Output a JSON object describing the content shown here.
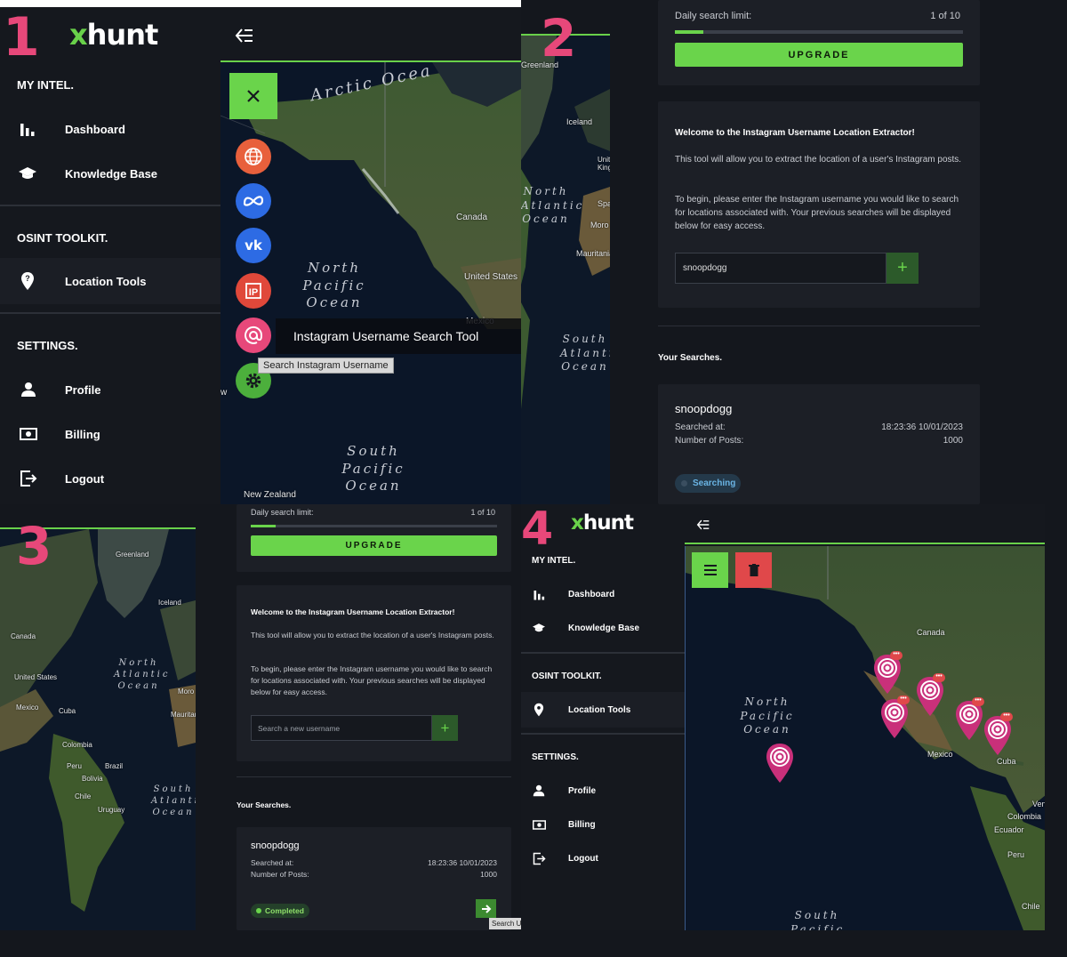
{
  "panel_numbers": [
    "1",
    "2",
    "3",
    "4"
  ],
  "brand": {
    "x": "x",
    "name": "hunt",
    "accent": "#69d14a",
    "number_color": "#e7487a"
  },
  "sidebar": {
    "sections": {
      "my_intel": "MY INTEL.",
      "osint": "OSINT TOOLKIT.",
      "settings": "SETTINGS."
    },
    "items": [
      {
        "label": "Dashboard",
        "icon": "bar-chart-icon"
      },
      {
        "label": "Knowledge Base",
        "icon": "graduation-cap-icon"
      },
      {
        "label": "Location Tools",
        "icon": "map-pin-icon"
      },
      {
        "label": "Profile",
        "icon": "user-icon"
      },
      {
        "label": "Billing",
        "icon": "money-icon"
      },
      {
        "label": "Logout",
        "icon": "logout-icon"
      }
    ]
  },
  "map_labels": {
    "arctic": "Arctic Ocea",
    "north_pacific": "North Pacific Ocean",
    "south_pacific": "South Pacific Ocean",
    "north_atlantic": "North Atlantic Ocean",
    "south_atlantic": "South Atlantic Ocean",
    "canada": "Canada",
    "united_states": "United States",
    "mexico": "Mexico",
    "new_zealand": "New Zealand",
    "greenland": "Greenland",
    "iceland": "Iceland",
    "cuba": "Cuba",
    "colombia": "Colombia",
    "ecuador": "Ecuador",
    "peru": "Peru",
    "chile": "Chile",
    "brazil": "Brazil",
    "bolivia": "Bolivia",
    "uruguay": "Uruguay",
    "united_kingdom": "United Kingdom",
    "spain": "Spa",
    "morocco": "Moro",
    "mauritania": "Mauritania",
    "venezuela": "Vene",
    "south_pacific_short": "South Pacific",
    "w": "w"
  },
  "panel1": {
    "tool_label": "Instagram Username Search Tool",
    "tooltip": "Search Instagram Username",
    "fabs": [
      {
        "icon": "globe-icon",
        "color": "#e8603c"
      },
      {
        "icon": "meta-icon",
        "color": "#2d6be4"
      },
      {
        "icon": "vk-icon",
        "color": "#2d6be4"
      },
      {
        "icon": "ip-icon",
        "color": "#e0483a"
      },
      {
        "icon": "at-sign-icon",
        "color": "#e7487a"
      },
      {
        "icon": "gear-icon",
        "color": "#4caf3c"
      }
    ]
  },
  "extractor": {
    "limit_label": "Daily search limit:",
    "limit_value": "1 of 10",
    "limit_fraction": 0.1,
    "upgrade": "UPGRADE",
    "welcome_title": "Welcome to the Instagram Username Location Extractor!",
    "welcome_p1": "This tool will allow you to extract the location of a user's Instagram posts.",
    "welcome_p2": "To begin, please enter the Instagram username you would like to search for locations associated with. Your previous searches will be displayed below for easy access.",
    "input_value_2": "snoopdogg",
    "input_placeholder_3": "Search a new username",
    "your_searches": "Your Searches.",
    "search_name": "snoopdogg",
    "searched_at_label": "Searched at:",
    "searched_at_value": "18:23:36 10/01/2023",
    "posts_label": "Number of Posts:",
    "posts_value": "1000",
    "status_searching": "Searching",
    "status_completed": "Completed",
    "search_tooltip": "Search U"
  }
}
